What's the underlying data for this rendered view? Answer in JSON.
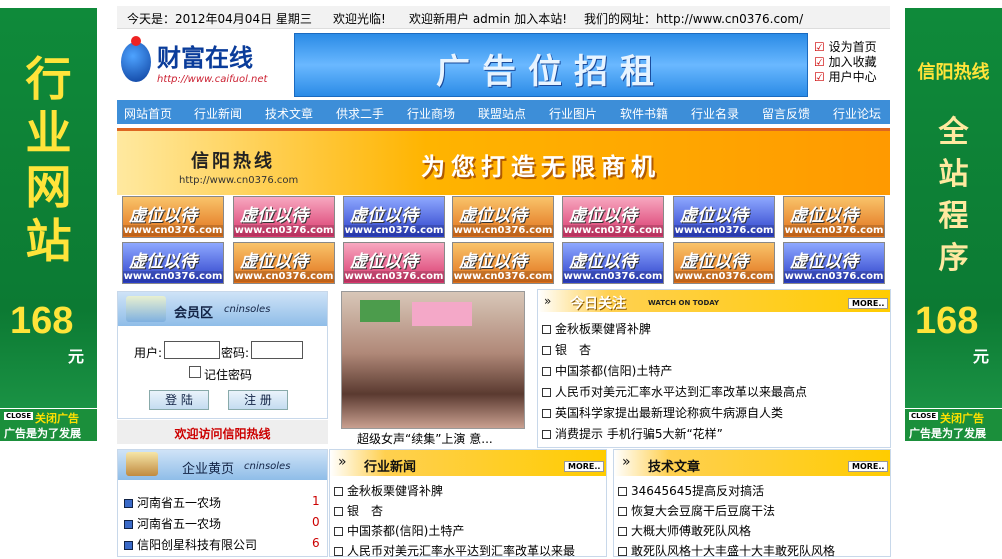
{
  "left_ad": {
    "title_chars": [
      "行",
      "业",
      "网",
      "站"
    ],
    "price": "168",
    "unit": "元",
    "close_tag": "CLOSE",
    "close_label": "关闭广告",
    "note": "广告是为了发展"
  },
  "right_ad": {
    "header": "信阳热线",
    "title_chars": [
      "全",
      "站",
      "程",
      "序"
    ],
    "price": "168",
    "unit": "元",
    "close_tag": "CLOSE",
    "close_label": "关闭广告",
    "note": "广告是为了发展"
  },
  "topbar": {
    "date": "今天是：2012年04月04日 星期三",
    "welcome": "欢迎光临!",
    "user": "欢迎新用户 admin 加入本站!",
    "site": "我们的网址：http://www.cn0376.com/"
  },
  "logo": {
    "name": "财富在线",
    "url": "http://www.caifuol.net"
  },
  "banner_ad": "广告位招租",
  "quick_links": [
    "设为首页",
    "加入收藏",
    "用户中心"
  ],
  "nav": [
    "网站首页",
    "行业新闻",
    "技术文章",
    "供求二手",
    "行业商场",
    "联盟站点",
    "行业图片",
    "软件书籍",
    "行业名录",
    "留言反馈",
    "行业论坛"
  ],
  "big_banner": {
    "brand": "信阳热线",
    "url": "http://www.cn0376.com",
    "slogan": "为您打造无限商机"
  },
  "tiles": {
    "title": "虚位以待",
    "url": "www.cn0376.com",
    "colors": [
      "#f0a030",
      "#e84c78",
      "#3a58d8",
      "#f0a030",
      "#e84c78",
      "#3a58d8",
      "#f0a030",
      "#3a58d8",
      "#f0a030",
      "#e84c78",
      "#f0a030",
      "#3a58d8",
      "#f0a030",
      "#3a58d8"
    ]
  },
  "member": {
    "title": "会员区",
    "subtitle": "cninsoles",
    "user_label": "用户:",
    "pass_label": "密码:",
    "remember": "记住密码",
    "login": "登 陆",
    "register": "注 册",
    "welcome": "欢迎访问信阳热线"
  },
  "photo": {
    "caption": "超级女声“续集”上演 意..."
  },
  "today": {
    "title": "今日关注",
    "subtitle": "WATCH ON TODAY",
    "more": "MORE..",
    "items": [
      "金秋板栗健肾补脾",
      "银　杏",
      "中国茶都(信阳)土特产",
      "人民币对美元汇率水平达到汇率改革以来最高点",
      "英国科学家提出最新理论称疯牛病源自人类",
      "消费提示 手机行骗5大新“花样”"
    ]
  },
  "yellow": {
    "title": "企业黄页",
    "subtitle": "cninsoles",
    "items": [
      {
        "name": "河南省五一农场",
        "count": "1"
      },
      {
        "name": "河南省五一农场",
        "count": "0"
      },
      {
        "name": "信阳创星科技有限公司",
        "count": "6"
      }
    ]
  },
  "news": {
    "title": "行业新闻",
    "more": "MORE..",
    "items": [
      "金秋板栗健肾补脾",
      "银　杏",
      "中国茶都(信阳)土特产",
      "人民币对美元汇率水平达到汇率改革以来最"
    ]
  },
  "tech": {
    "title": "技术文章",
    "more": "MORE..",
    "items": [
      "34645645提高反对搞活",
      "恢复大会豆腐干后豆腐干法",
      "大概大师傅敢死队风格",
      "敢死队风格十大丰盛十大丰敢死队风格"
    ]
  }
}
